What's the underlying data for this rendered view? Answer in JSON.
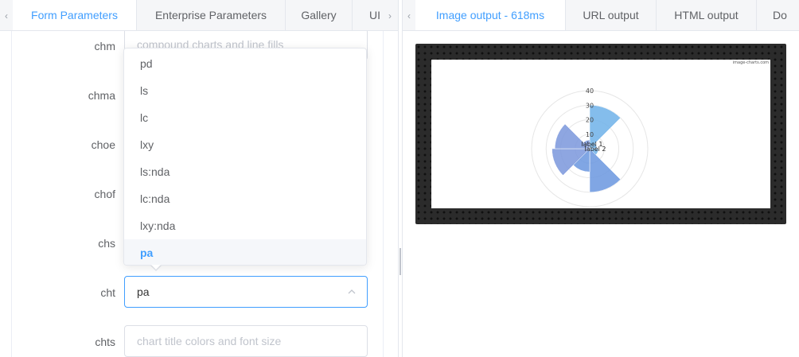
{
  "left_tabs": {
    "prev_arrow": "‹",
    "next_arrow": "›",
    "items": [
      {
        "label": "Form Parameters",
        "active": true
      },
      {
        "label": "Enterprise Parameters",
        "active": false
      },
      {
        "label": "Gallery",
        "active": false
      },
      {
        "label": "UI",
        "active": false
      }
    ]
  },
  "form": {
    "rows": [
      {
        "label": "chm",
        "placeholder": "compound charts and line fills"
      },
      {
        "label": "chma"
      },
      {
        "label": "choe"
      },
      {
        "label": "chof"
      },
      {
        "label": "chs"
      },
      {
        "label": "cht",
        "value": "pa"
      },
      {
        "label": "chts",
        "placeholder": "chart title colors and font size"
      }
    ]
  },
  "dropdown": {
    "options": [
      "pd",
      "ls",
      "lc",
      "lxy",
      "ls:nda",
      "lc:nda",
      "lxy:nda",
      "pa"
    ],
    "selected": "pa"
  },
  "right_tabs": {
    "prev_arrow": "‹",
    "items": [
      {
        "label": "Image output - 618ms",
        "active": true
      },
      {
        "label": "URL output",
        "active": false
      },
      {
        "label": "HTML output",
        "active": false
      },
      {
        "label": "Do",
        "active": false
      }
    ]
  },
  "preview": {
    "watermark": "image-charts.com",
    "accent_color": "#409eff",
    "chart_data": {
      "type": "polar-area",
      "axis_ticks": [
        "10",
        "20",
        "30",
        "40"
      ],
      "rlim": [
        0,
        40
      ],
      "labels": [
        "label 1",
        "label 2"
      ],
      "values": [
        30,
        5,
        6,
        30,
        16,
        26,
        24,
        6
      ],
      "colors": [
        "#6fb2e9",
        "#6fb2e9",
        "#6fb2e9",
        "#6a97df",
        "#6a97df",
        "#7a96dc",
        "#7a96dc",
        "#7a96dc"
      ]
    }
  }
}
